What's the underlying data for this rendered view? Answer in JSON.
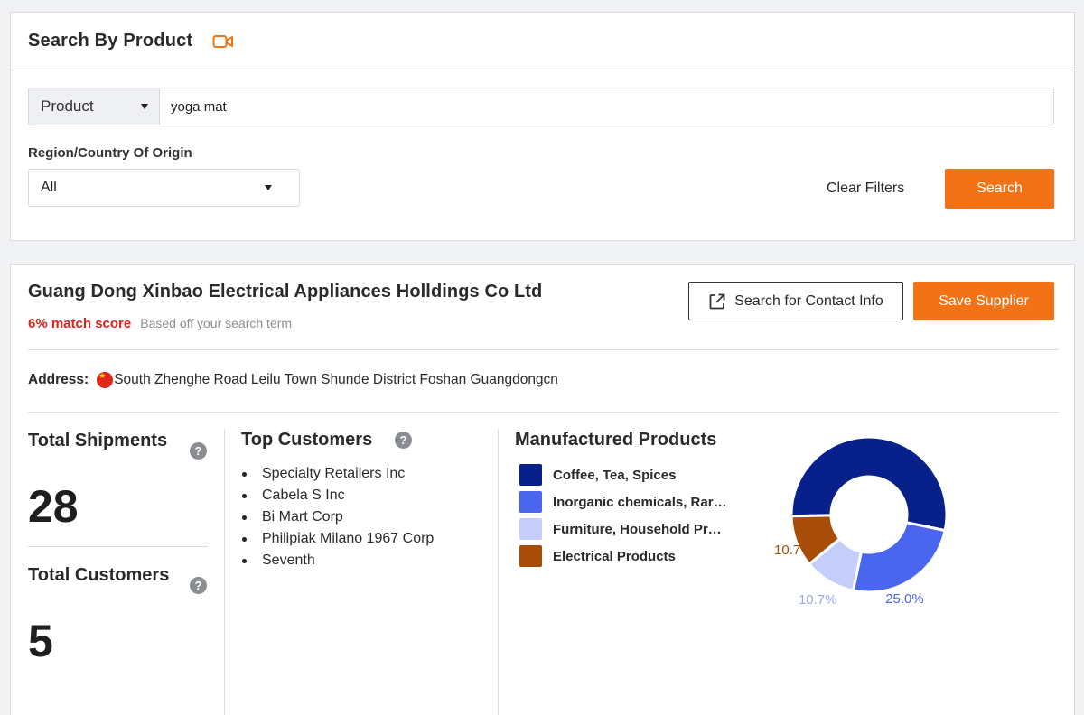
{
  "search_panel": {
    "title": "Search By Product",
    "product_type": "Product",
    "query": "yoga mat",
    "region_label": "Region/Country Of Origin",
    "region_value": "All",
    "clear_filters_label": "Clear Filters",
    "search_label": "Search"
  },
  "supplier": {
    "name": "Guang Dong Xinbao Electrical Appliances Holldings Co Ltd",
    "match_score": "6% match score",
    "match_note": "Based off your search term",
    "contact_button_label": "Search for Contact Info",
    "save_button_label": "Save Supplier",
    "address_label": "Address:",
    "address": "South Zhenghe Road Leilu Town Shunde District Foshan Guangdongcn",
    "total_shipments_label": "Total Shipments",
    "total_shipments": "28",
    "total_customers_label": "Total Customers",
    "total_customers": "5",
    "top_customers_title": "Top Customers",
    "top_customers": [
      "Specialty Retailers Inc",
      "Cabela S Inc",
      "Bi Mart Corp",
      "Philipiak Milano 1967 Corp",
      "Seventh"
    ],
    "products_title": "Manufactured Products"
  },
  "icons": {
    "video": "video-icon",
    "external_link": "external-link-icon",
    "help": "help-icon",
    "flag": "china-flag-icon",
    "caret": "caret-down-icon"
  },
  "colors": {
    "accent": "#f47216",
    "match_red": "#d9231d"
  },
  "chart_data": {
    "type": "pie",
    "donut": true,
    "labels": [
      "Coffee, Tea, Spices",
      "Inorganic chemicals, Rar…",
      "Furniture, Household Pr…",
      "Electrical Products"
    ],
    "values": [
      53.6,
      25.0,
      10.7,
      10.7
    ],
    "value_labels": [
      "53.6%",
      "25.0%",
      "10.7%",
      "10.7%"
    ],
    "colors": [
      "#07208a",
      "#4a66ef",
      "#c5cdfa",
      "#a84d07"
    ],
    "legend": "left"
  }
}
